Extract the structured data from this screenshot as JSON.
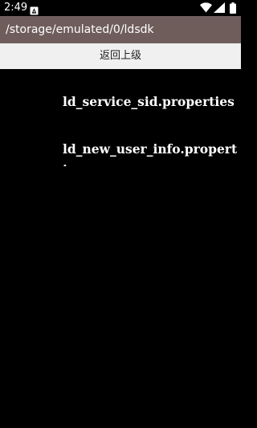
{
  "status_bar": {
    "time": "2:49",
    "icons": [
      "notification-icon",
      "wifi-icon",
      "cell-signal-icon",
      "battery-icon"
    ]
  },
  "path_bar": {
    "path": "/storage/emulated/0/ldsdk",
    "background_color": "#6f5d5c"
  },
  "back_button": {
    "label": "返回上级"
  },
  "files": [
    {
      "name": "ld_service_sid.properties"
    },
    {
      "name": "ld_new_user_info.properties"
    }
  ]
}
